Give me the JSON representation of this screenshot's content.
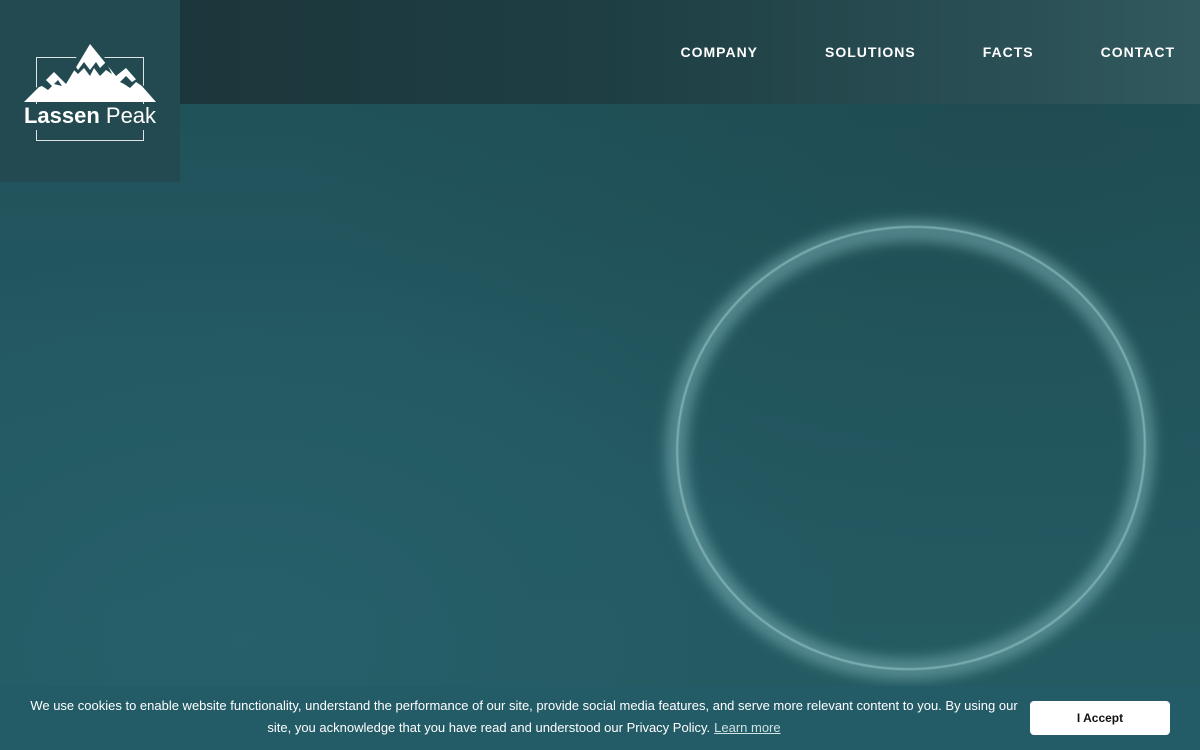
{
  "brand": {
    "name_bold": "Lassen",
    "name_light": "Peak",
    "logo_icon": "mountain-peaks-icon"
  },
  "nav": {
    "items": [
      {
        "label": "COMPANY"
      },
      {
        "label": "SOLUTIONS"
      },
      {
        "label": "FACTS"
      },
      {
        "label": "CONTACT"
      }
    ]
  },
  "cookie": {
    "message": "We use cookies to enable website functionality, understand the performance of our site, provide social media features, and serve more relevant content to you. By using our site, you acknowledge that you have read and understood our Privacy Policy.",
    "learn_more": "Learn more",
    "accept_label": "I Accept"
  },
  "colors": {
    "background": "#235860",
    "topbar": "#1e3e43",
    "cookie_bar": "#235c67",
    "accent_ring": "#78afb4"
  }
}
